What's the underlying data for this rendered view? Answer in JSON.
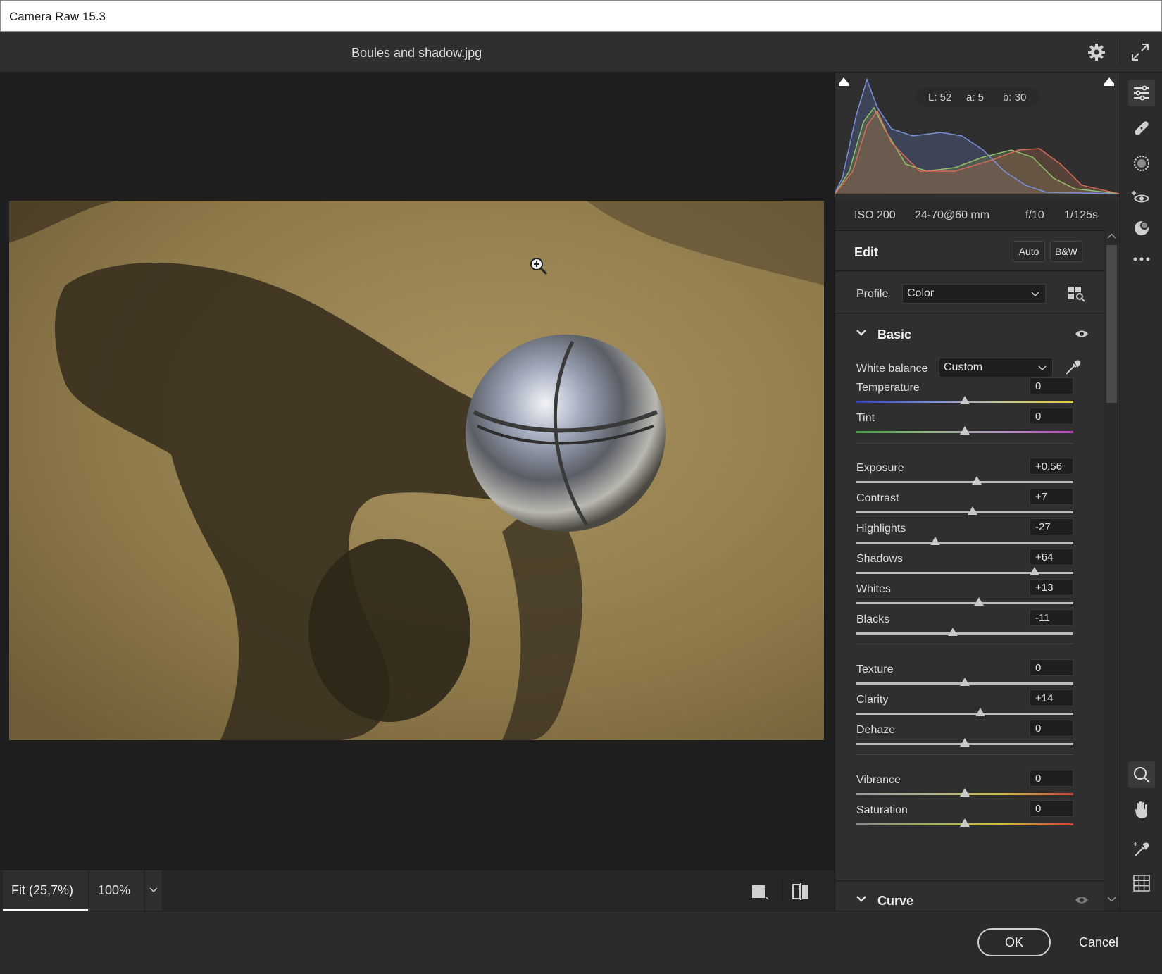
{
  "window": {
    "title": "Camera Raw 15.3"
  },
  "header": {
    "filename": "Boules and shadow.jpg"
  },
  "histogram": {
    "L_label": "L: 52",
    "a_label": "a: 5",
    "b_label": "b: 30"
  },
  "metadata": {
    "iso": "ISO 200",
    "lens": "24-70@60 mm",
    "aperture": "f/10",
    "shutter": "1/125s"
  },
  "edit": {
    "title": "Edit",
    "auto_label": "Auto",
    "bw_label": "B&W"
  },
  "profile": {
    "label": "Profile",
    "value": "Color"
  },
  "basic": {
    "title": "Basic",
    "white_balance": {
      "label": "White balance",
      "value": "Custom"
    },
    "sliders": [
      {
        "label": "Temperature",
        "value": "0",
        "position": 0.5
      },
      {
        "label": "Tint",
        "value": "0",
        "position": 0.5
      },
      {
        "label": "Exposure",
        "value": "+0.56",
        "position": 0.556
      },
      {
        "label": "Contrast",
        "value": "+7",
        "position": 0.535
      },
      {
        "label": "Highlights",
        "value": "-27",
        "position": 0.365
      },
      {
        "label": "Shadows",
        "value": "+64",
        "position": 0.82
      },
      {
        "label": "Whites",
        "value": "+13",
        "position": 0.565
      },
      {
        "label": "Blacks",
        "value": "-11",
        "position": 0.445
      },
      {
        "label": "Texture",
        "value": "0",
        "position": 0.5
      },
      {
        "label": "Clarity",
        "value": "+14",
        "position": 0.57
      },
      {
        "label": "Dehaze",
        "value": "0",
        "position": 0.5
      },
      {
        "label": "Vibrance",
        "value": "0",
        "position": 0.5
      },
      {
        "label": "Saturation",
        "value": "0",
        "position": 0.5
      }
    ]
  },
  "curve": {
    "title": "Curve"
  },
  "zoom": {
    "fit_label": "Fit (25,7%)",
    "hundred_label": "100%"
  },
  "footer": {
    "ok_label": "OK",
    "cancel_label": "Cancel"
  },
  "colors": {
    "accent": "#ffffff",
    "panel_bg": "#2f2f2f",
    "canvas_bg": "#1e1e1e"
  },
  "tools": [
    "edit-sliders-icon",
    "healing-icon",
    "masking-icon",
    "redeye-icon",
    "presets-icon",
    "more-icon",
    "zoom-icon",
    "hand-icon",
    "color-sampler-icon",
    "grid-icon"
  ]
}
